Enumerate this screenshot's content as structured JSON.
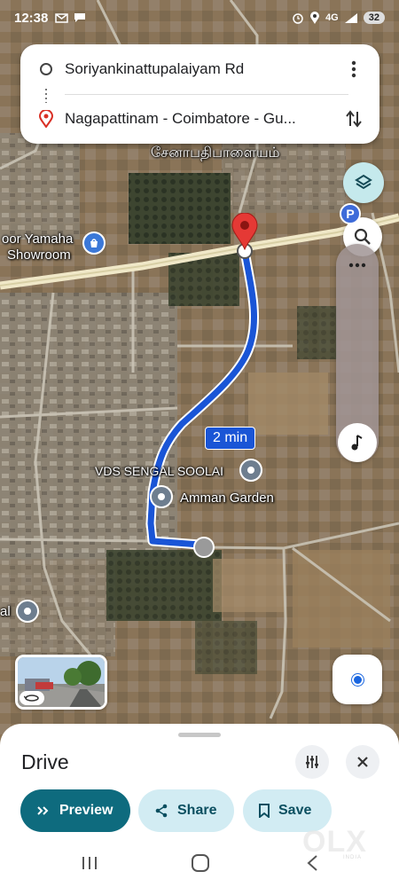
{
  "status_bar": {
    "time": "12:38",
    "notification_icons": [
      "gmail-icon",
      "chat-icon"
    ],
    "system_icons": [
      "alarm-icon",
      "location-icon",
      "volte-icon",
      "signal-icon"
    ],
    "network": "4G",
    "battery": "32"
  },
  "directions": {
    "origin": "Soriyankinattupalaiyam Rd",
    "destination": "Nagapattinam - Coimbatore - Gu..."
  },
  "map": {
    "labels": {
      "top_town": "சேனாபதிபாளையம்",
      "yamaha_line1": "oor Yamaha",
      "yamaha_line2": "Showroom",
      "vds": "VDS SENGAL SOOLAI",
      "amman": "Amman Garden",
      "left_cut": "al"
    },
    "route_time": "2 min",
    "route_color": "#1a55d6",
    "destination_pin_color": "#e53935",
    "parking_label": "P"
  },
  "bottom_sheet": {
    "title": "Drive",
    "preview_label": "Preview",
    "share_label": "Share",
    "save_label": "Save"
  },
  "watermark": {
    "brand": "OLX",
    "sub": "INDIA"
  },
  "colors": {
    "preview_bg": "#0e6b7e",
    "secondary_pill_bg": "#d2ecf3",
    "layers_bg": "#c5e9ec",
    "location_dot": "#1a66e0"
  }
}
